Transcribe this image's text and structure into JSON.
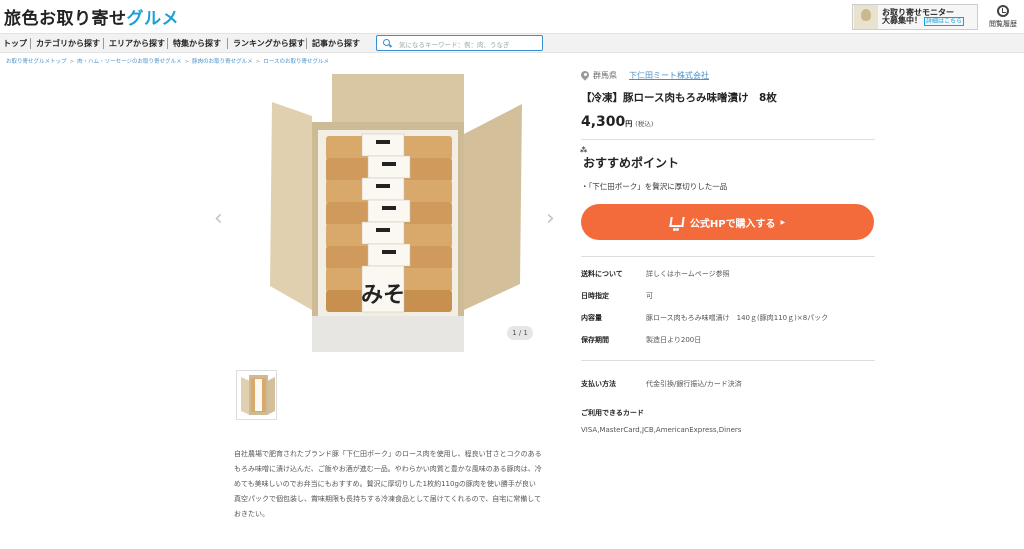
{
  "header": {
    "logo_main": "旅色お取り寄せ",
    "logo_accent": "グルメ",
    "banner_line1": "お取り寄せモニター",
    "banner_line2": "大募集中！",
    "banner_link": "詳細はこちら",
    "history_label": "閲覧履歴"
  },
  "nav": {
    "items": [
      "トップ",
      "カテゴリから探す",
      "エリアから探す",
      "特集から探す",
      "ランキングから探す",
      "記事から探す"
    ],
    "search_placeholder": "気になるキーワード：例：肉、うなぎ"
  },
  "breadcrumb": [
    "お取り寄せグルメトップ",
    "肉・ハム・ソーセージのお取り寄せグルメ",
    "豚肉のお取り寄せグルメ",
    "ロースのお取り寄せグルメ"
  ],
  "gallery": {
    "counter": "1 / 1",
    "description": "自社農場で肥育されたブランド豚「下仁田ポーク」のロース肉を使用し、程良い甘さとコクのあるもろみ味噌に漬け込んだ、ご飯やお酒が進む一品。やわらかい肉質と豊かな風味のある豚肉は、冷めても美味しいのでお弁当にもおすすめ。贅沢に厚切りした1枚約110gの豚肉を使い勝手が良い真空パックで個包装し、賞味期限も長持ちする冷凍食品として届けてくれるので、自宅に常備しておきたい。",
    "package_label": "みそ"
  },
  "product": {
    "prefecture": "群馬県",
    "company": "下仁田ミート株式会社",
    "title": "【冷凍】豚ロース肉もろみ味噌漬け　8枚",
    "price": "4,300",
    "price_unit": "円",
    "tax_note": "(税込)",
    "recommend_title": "おすすめポイント",
    "recommend_point": "・「下仁田ポーク」を贅沢に厚切りした一品",
    "buy_button": "公式HPで購入する",
    "specs": [
      {
        "label": "送料について",
        "value": "詳しくはホームページ参照"
      },
      {
        "label": "日時指定",
        "value": "可"
      },
      {
        "label": "内容量",
        "value": "豚ロース肉もろみ味噌漬け　140ｇ(豚肉110ｇ)×8パック"
      },
      {
        "label": "保存期間",
        "value": "製造日より200日"
      }
    ],
    "payment_label": "支払い方法",
    "payment_value": "代金引換/銀行振込/カード決済",
    "cards_label": "ご利用できるカード",
    "cards_value": "VISA,MasterCard,JCB,AmericanExpress,Diners"
  },
  "colors": {
    "accent_blue": "#1aa0d8",
    "buy_orange": "#f36b3b"
  }
}
